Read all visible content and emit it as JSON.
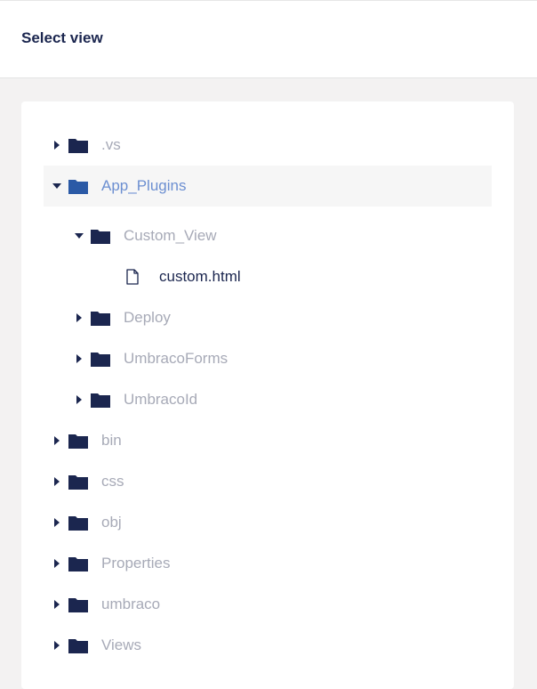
{
  "header": {
    "title": "Select view"
  },
  "colors": {
    "folder": "#1b264f",
    "folder_selected": "#2b5aa6",
    "text_muted": "#a7aab7",
    "text_selected": "#6c8fd1",
    "text_dark": "#1b264f"
  },
  "tree": [
    {
      "label": ".vs",
      "type": "folder",
      "expanded": false,
      "depth": 0,
      "icon": "folder-icon"
    },
    {
      "label": "App_Plugins",
      "type": "folder",
      "expanded": true,
      "depth": 0,
      "selected": true,
      "icon": "folder-icon"
    },
    {
      "label": "Custom_View",
      "type": "folder",
      "expanded": true,
      "depth": 1,
      "icon": "folder-icon"
    },
    {
      "label": "custom.html",
      "type": "file",
      "depth": 2,
      "icon": "file-icon"
    },
    {
      "label": "Deploy",
      "type": "folder",
      "expanded": false,
      "depth": 1,
      "icon": "folder-icon"
    },
    {
      "label": "UmbracoForms",
      "type": "folder",
      "expanded": false,
      "depth": 1,
      "icon": "folder-icon"
    },
    {
      "label": "UmbracoId",
      "type": "folder",
      "expanded": false,
      "depth": 1,
      "icon": "folder-icon"
    },
    {
      "label": "bin",
      "type": "folder",
      "expanded": false,
      "depth": 0,
      "icon": "folder-icon"
    },
    {
      "label": "css",
      "type": "folder",
      "expanded": false,
      "depth": 0,
      "icon": "folder-icon"
    },
    {
      "label": "obj",
      "type": "folder",
      "expanded": false,
      "depth": 0,
      "icon": "folder-icon"
    },
    {
      "label": "Properties",
      "type": "folder",
      "expanded": false,
      "depth": 0,
      "icon": "folder-icon"
    },
    {
      "label": "umbraco",
      "type": "folder",
      "expanded": false,
      "depth": 0,
      "icon": "folder-icon"
    },
    {
      "label": "Views",
      "type": "folder",
      "expanded": false,
      "depth": 0,
      "icon": "folder-icon"
    }
  ]
}
